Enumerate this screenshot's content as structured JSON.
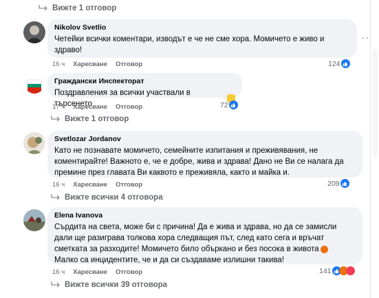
{
  "colors": {
    "accent": "#1877f2",
    "meta_text": "#65676b",
    "bubble": "#f0f2f5"
  },
  "comments": [
    {
      "top_replies": "Вижте 1 отговор",
      "author": "Nikolov Svetlio",
      "text_lines": [
        "Четейки всички коментари, изводът е че не сме хора. Момичето е живо и",
        "здраво!"
      ],
      "time": "16 ч",
      "like": "Харесване",
      "reply": "Отговор",
      "reactions": "124",
      "reaction_icons": [
        "like-icon"
      ]
    },
    {
      "author": "Граждански Инспекторат",
      "text_lines": [
        "Поздравления за всички участвали в търсенето"
      ],
      "emoji": "clapping-hands-emoji",
      "time": "17 ч",
      "like": "Харесване",
      "reply": "Отговор",
      "reactions": "72",
      "reaction_icons": [
        "like-icon"
      ],
      "view_replies": "Вижте 1 отговор"
    },
    {
      "author": "Svetlozar Jordanov",
      "text_lines": [
        "Като не познавате момичето, семейните изпитания и преживявания, не",
        "коментирайте! Важното е, че е добре, жива и здрава! Дано не Ви се налага да",
        "премине през главата Ви каквото е преживяла, както и майка и."
      ],
      "time": "16 ч",
      "like": "Харесване",
      "reply": "Отговор",
      "reactions": "209",
      "reaction_icons": [
        "like-icon"
      ],
      "view_replies": "Вижте всички 4 отговора"
    },
    {
      "author": "Elena Ivanova",
      "text_lines": [
        "Сърдита на света, може би с причина! Да е жива и здрава, но да се замисли",
        "дали ще разиграва толкова хора следващия път, след като сега и връчат",
        "сметката за разходите! Момичето било объркано и без посока в живота",
        "Малко са инцидентите, че и да си създаваме излишни такива!"
      ],
      "emoji": "angry-face-emoji",
      "time": "16 ч",
      "like": "Харесване",
      "reply": "Отговор",
      "reactions": "141",
      "reaction_icons": [
        "like-icon",
        "angry-icon",
        "heart-icon"
      ],
      "view_replies": "Вижте всички 39 отговора"
    }
  ]
}
